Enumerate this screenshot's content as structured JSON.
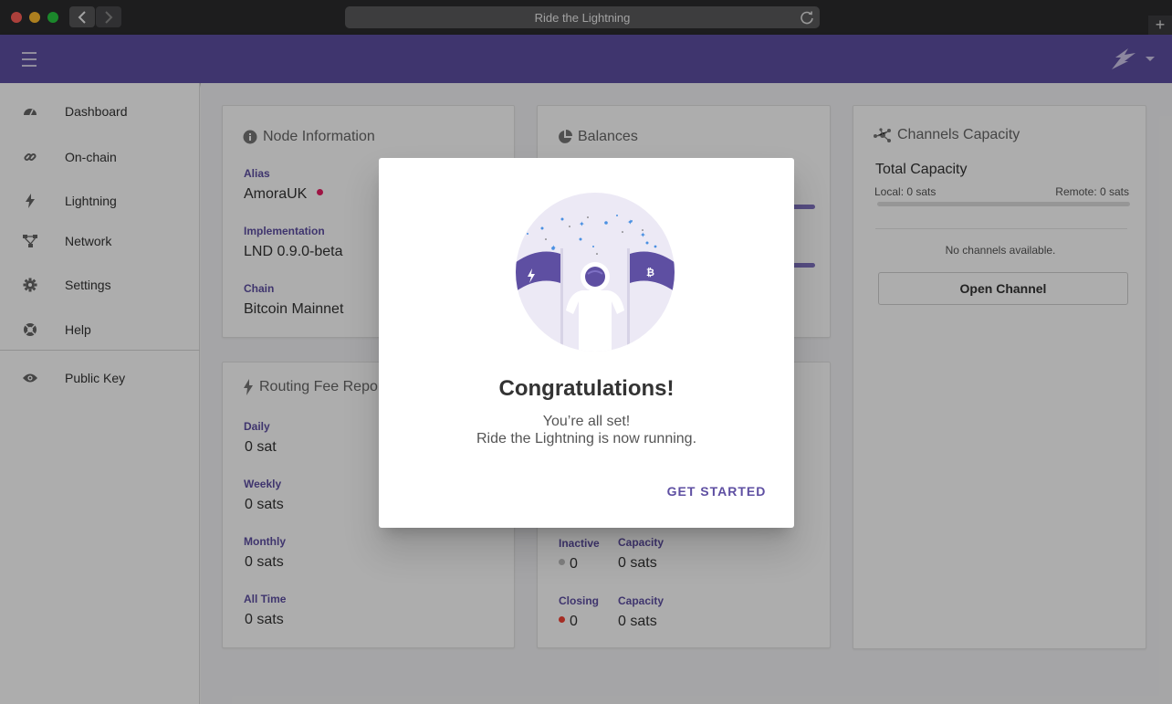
{
  "browser": {
    "url_title": "Ride the Lightning"
  },
  "sidebar": {
    "items": [
      {
        "label": "Dashboard",
        "icon": "dashboard-icon"
      },
      {
        "label": "On-chain",
        "icon": "link-icon"
      },
      {
        "label": "Lightning",
        "icon": "bolt-icon"
      },
      {
        "label": "Network",
        "icon": "network-icon"
      },
      {
        "label": "Settings",
        "icon": "gear-icon"
      },
      {
        "label": "Help",
        "icon": "help-icon"
      },
      {
        "label": "Public Key",
        "icon": "eye-icon"
      }
    ]
  },
  "node_info": {
    "title": "Node Information",
    "alias_label": "Alias",
    "alias": "AmoraUK",
    "impl_label": "Implementation",
    "impl": "LND 0.9.0-beta",
    "chain_label": "Chain",
    "chain": "Bitcoin Mainnet"
  },
  "balances": {
    "title": "Balances"
  },
  "channels_capacity": {
    "title": "Channels Capacity",
    "total_label": "Total Capacity",
    "local": "Local: 0 sats",
    "remote": "Remote: 0 sats",
    "empty_text": "No channels available.",
    "open_button": "Open Channel"
  },
  "routing_fee": {
    "title": "Routing Fee Report",
    "daily_label": "Daily",
    "daily": "0 sat",
    "weekly_label": "Weekly",
    "weekly": "0 sats",
    "monthly_label": "Monthly",
    "monthly": "0 sats",
    "alltime_label": "All Time",
    "alltime": "0 sats"
  },
  "channel_status": {
    "inactive_label": "Inactive",
    "inactive_count": "0",
    "inactive_cap_label": "Capacity",
    "inactive_cap": "0 sats",
    "closing_label": "Closing",
    "closing_count": "0",
    "closing_cap_label": "Capacity",
    "closing_cap": "0 sats"
  },
  "dialog": {
    "title": "Congratulations!",
    "line1": "You’re all set!",
    "line2": "Ride the Lightning is now running.",
    "button": "GET STARTED"
  },
  "colors": {
    "primary": "#5e4fa2",
    "alias_dot": "#e91e63",
    "closing_dot": "#f44336",
    "inactive_dot": "#bdbdbd"
  }
}
